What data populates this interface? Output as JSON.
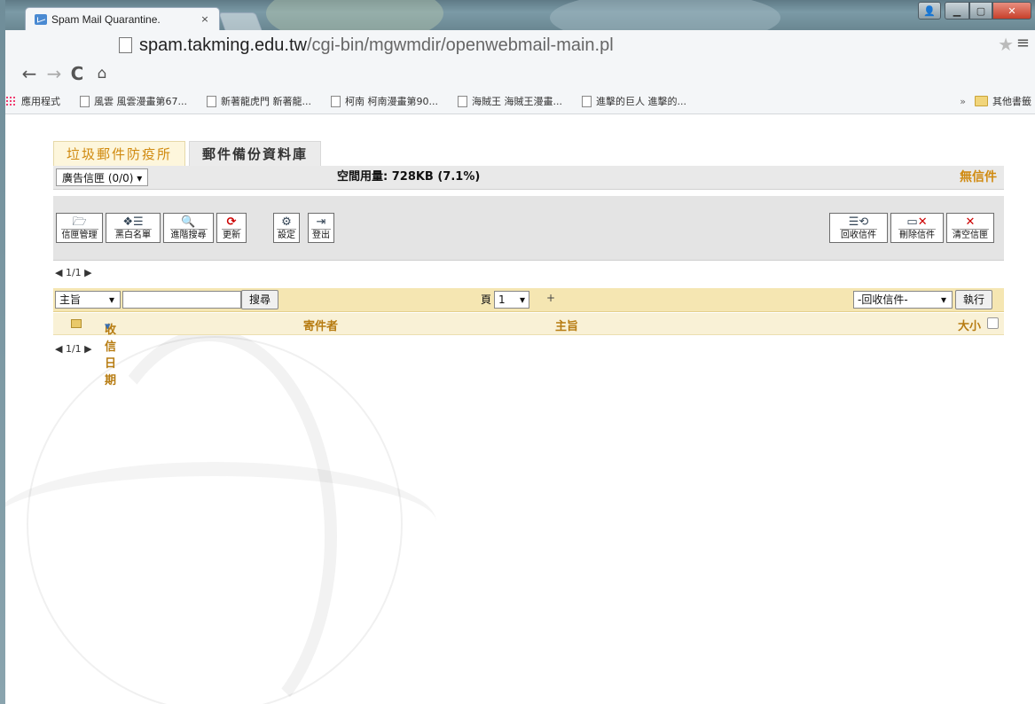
{
  "browser": {
    "tab_title": "Spam Mail Quarantine.",
    "tab_close": "×",
    "url_host": "spam.takming.edu.tw",
    "url_path": "/cgi-bin/mgwmdir/openwebmail-main.pl",
    "bookmarks": [
      "應用程式",
      "風雲 風雲漫畫第67...",
      "新著龍虎門 新著龍...",
      "柯南 柯南漫畫第90...",
      "海賊王 海賊王漫畫...",
      "進擊的巨人 進擊的..."
    ],
    "bookmarks_more": "»",
    "other_bookmarks": "其他書籤"
  },
  "tabs": [
    {
      "label": "垃圾郵件防疫所",
      "active": true
    },
    {
      "label": "郵件備份資料庫",
      "active": false
    }
  ],
  "folder_select": "廣告信匣 (0/0) ▾",
  "quota": "空間用量: 728KB (7.1%)",
  "no_mail": "無信件",
  "toolbar_left": [
    {
      "label": "信匣管理",
      "icon": "folder-icon"
    },
    {
      "label": "黑白名單",
      "icon": "list-icon"
    },
    {
      "label": "進階搜尋",
      "icon": "search-icon"
    },
    {
      "label": "更新",
      "icon": "refresh-icon"
    }
  ],
  "toolbar_mid": [
    {
      "label": "設定",
      "icon": "settings-icon"
    },
    {
      "label": "登出",
      "icon": "logout-icon"
    }
  ],
  "toolbar_right": [
    {
      "label": "回收信件",
      "icon": "recover-icon"
    },
    {
      "label": "刪除信件",
      "icon": "delete-icon"
    },
    {
      "label": "清空信匣",
      "icon": "clear-icon"
    }
  ],
  "pager": "◀ 1/1 ▶",
  "search": {
    "field_select": "主旨",
    "input_value": "",
    "button": "搜尋"
  },
  "page_label": "頁",
  "page_select": "1",
  "page_plus": "+",
  "action_select": "-回收信件-",
  "action_button": "執行",
  "columns": {
    "date": "收信日期",
    "sender": "寄件者",
    "subject": "主旨",
    "size": "大小"
  }
}
